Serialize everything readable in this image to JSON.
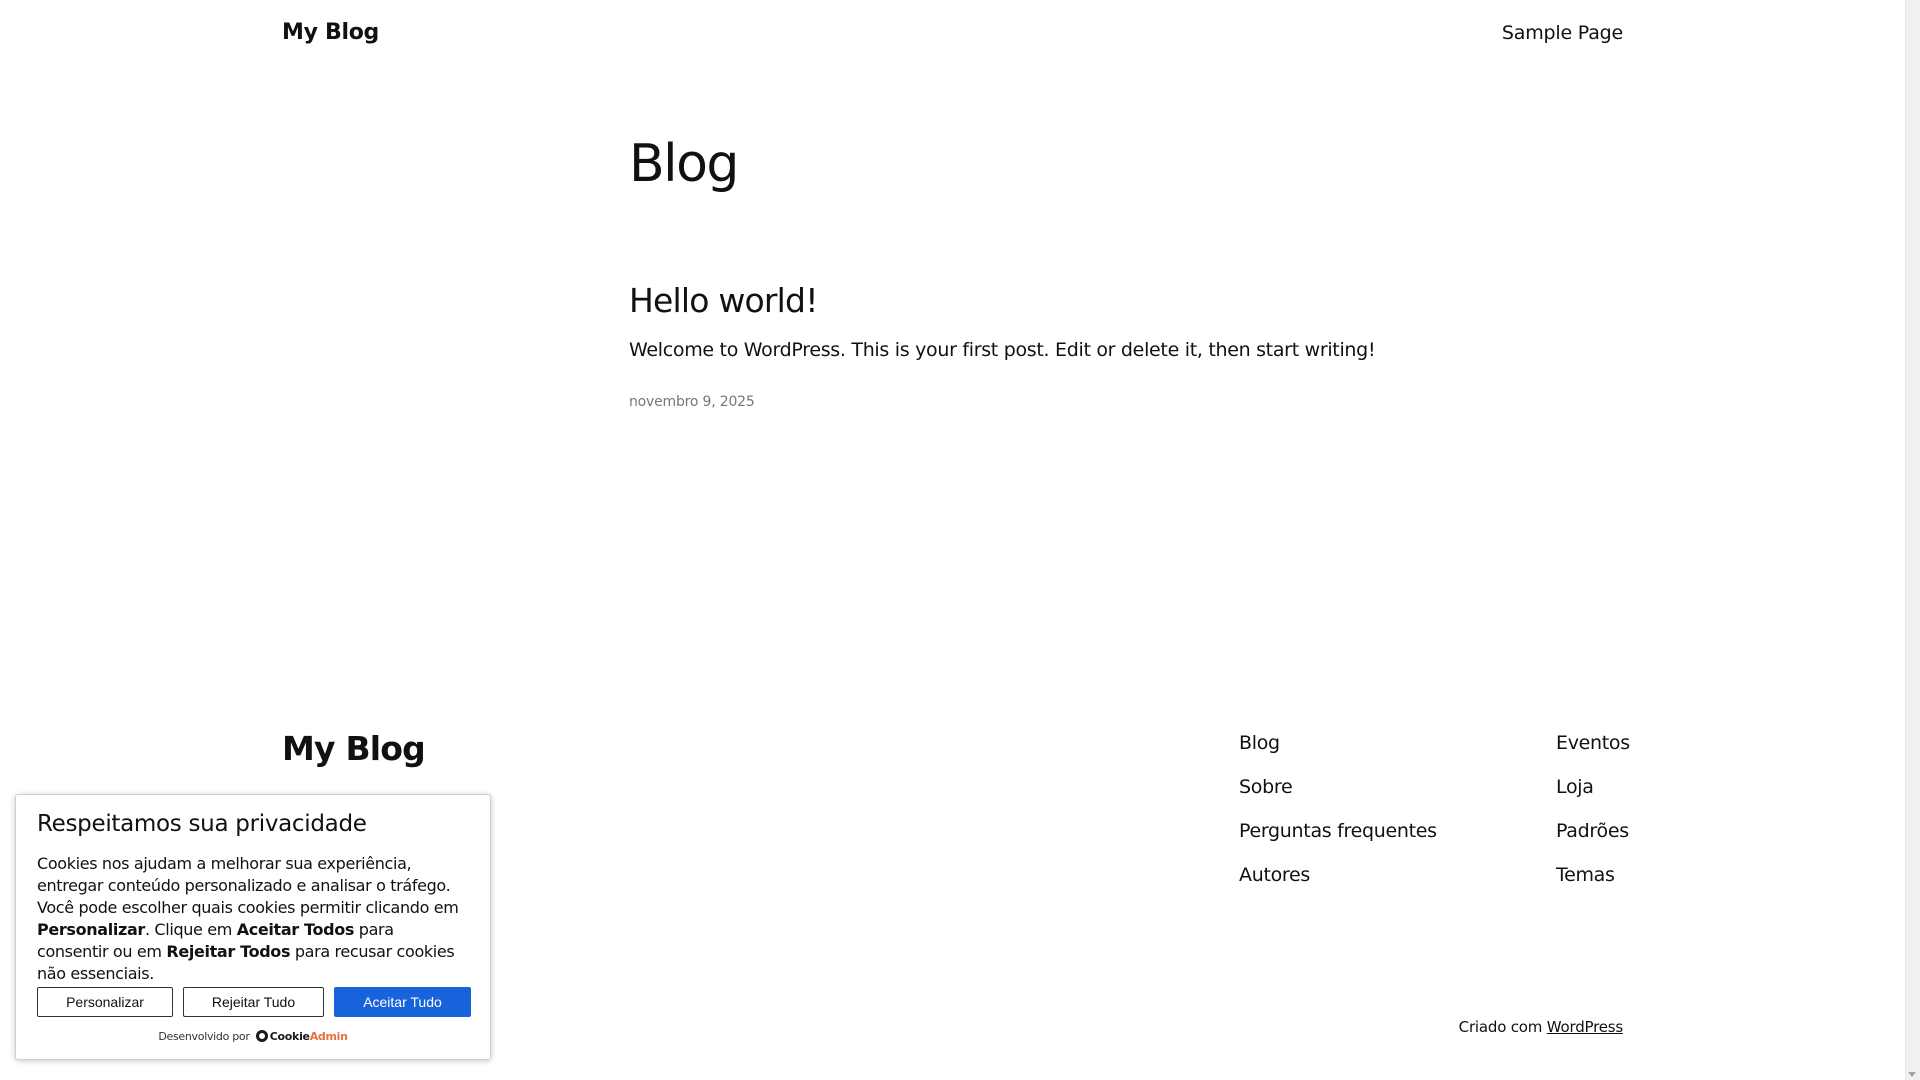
{
  "header": {
    "site_title": "My Blog",
    "nav": [
      "Sample Page"
    ]
  },
  "main": {
    "page_heading": "Blog",
    "posts": [
      {
        "title": "Hello world!",
        "excerpt": "Welcome to WordPress. This is your first post. Edit or delete it, then start writing!",
        "date": "novembro 9, 2025"
      }
    ]
  },
  "footer": {
    "site_title": "My Blog",
    "column_one": [
      "Blog",
      "Sobre",
      "Perguntas frequentes",
      "Autores"
    ],
    "column_two": [
      "Eventos",
      "Loja",
      "Padrões",
      "Temas"
    ],
    "credit_prefix": "Criado com",
    "credit_link": "WordPress"
  },
  "cookie_banner": {
    "title": "Respeitamos sua privacidade",
    "text_1": "Cookies nos ajudam a melhorar sua experiência, entregar conteúdo personalizado e analisar o tráfego. Você pode escolher quais cookies permitir clicando em ",
    "bold_1": "Personalizar",
    "text_2": ". Clique em ",
    "bold_2": "Aceitar Todos",
    "text_3": " para consentir ou em ",
    "bold_3": "Rejeitar Todos",
    "text_4": " para recusar cookies não essenciais.",
    "buttons": {
      "customize": "Personalizar",
      "reject": "Rejeitar Tudo",
      "accept": "Aceitar Tudo"
    },
    "powered_by": "Desenvolvido por",
    "logo_part_1": "Cookie",
    "logo_part_2": "Admin",
    "accent_color": "#1863dc"
  }
}
